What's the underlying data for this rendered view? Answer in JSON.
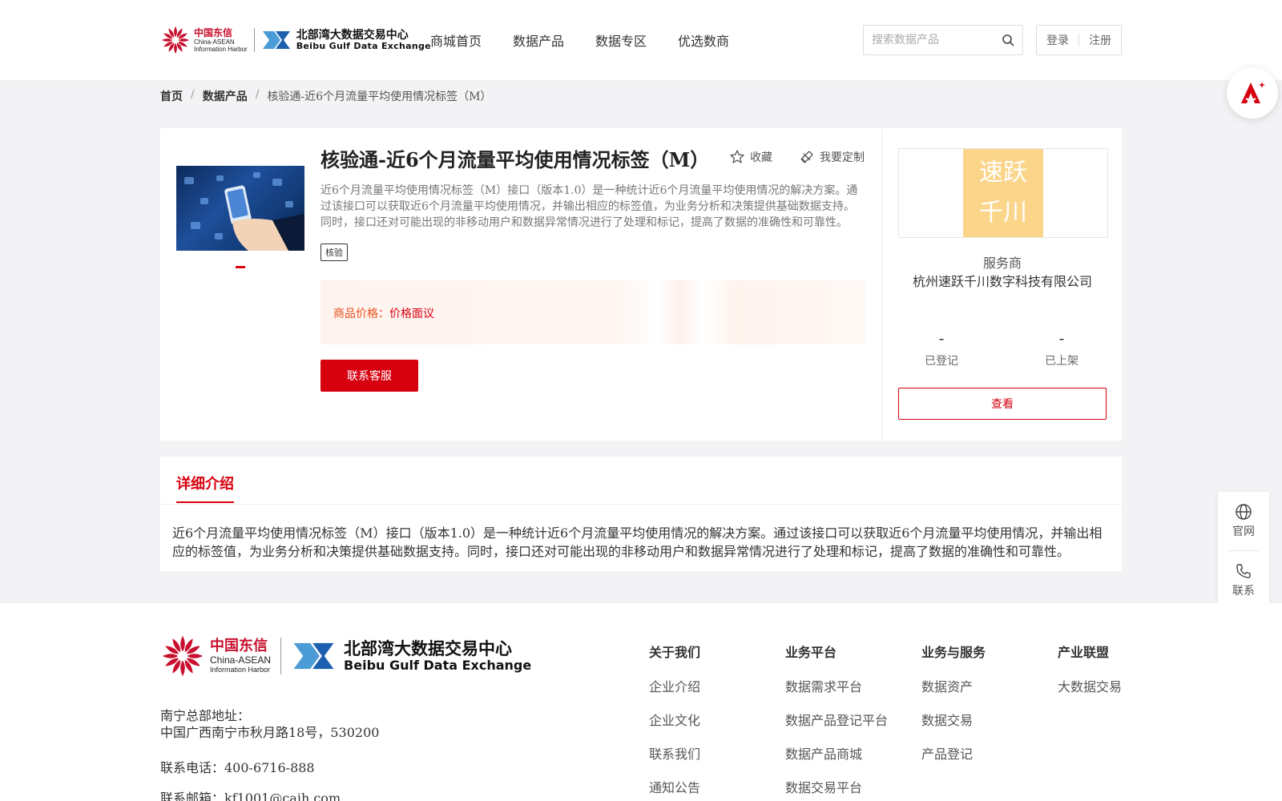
{
  "colors": {
    "brand_red": "#d7000f",
    "price_orange": "#e8501e",
    "bg_gray": "#f3f3f5",
    "vendor_logo_bg": "#fbd58a"
  },
  "header": {
    "logo": {
      "cn_top": "中国东信",
      "en_top": "China-ASEAN",
      "en_bottom": "Information Harbor",
      "bx_cn": "北部湾大数据交易中心",
      "bx_en": "Beibu Gulf Data Exchange"
    },
    "nav": [
      "商城首页",
      "数据产品",
      "数据专区",
      "优选数商"
    ],
    "search": {
      "placeholder": "搜索数据产品",
      "icon": "search-icon"
    },
    "auth": {
      "login": "登录",
      "register": "注册"
    }
  },
  "breadcrumb": {
    "home": "首页",
    "category": "数据产品",
    "sep": "/",
    "current": "核验通-近6个月流量平均使用情况标签（M）"
  },
  "product": {
    "title": "核验通-近6个月流量平均使用情况标签（M）",
    "favorite_label": "收藏",
    "custom_label": "我要定制",
    "description": "近6个月流量平均使用情况标签（M）接口（版本1.0）是一种统计近6个月流量平均使用情况的解决方案。通过该接口可以获取近6个月流量平均使用情况，并输出相应的标签值，为业务分析和决策提供基础数据支持。同时，接口还对可能出现的非移动用户和数据异常情况进行了处理和标记，提高了数据的准确性和可靠性。",
    "tag": "核验",
    "price_label": "商品价格：",
    "price_value": "价格面议",
    "contact_button": "联系客服"
  },
  "vendor": {
    "logo_line1": "速跃",
    "logo_line2": "千川",
    "role": "服务商",
    "name": "杭州速跃千川数字科技有限公司",
    "stats": [
      {
        "value": "-",
        "label": "已登记"
      },
      {
        "value": "-",
        "label": "已上架"
      }
    ],
    "view_button": "查看"
  },
  "detail": {
    "tab": "详细介绍",
    "text": "近6个月流量平均使用情况标签（M）接口（版本1.0）是一种统计近6个月流量平均使用情况的解决方案。通过该接口可以获取近6个月流量平均使用情况，并输出相应的标签值，为业务分析和决策提供基础数据支持。同时，接口还对可能出现的非移动用户和数据异常情况进行了处理和标记，提高了数据的准确性和可靠性。"
  },
  "side_tools": [
    {
      "label": "官网",
      "icon": "globe-icon"
    },
    {
      "label": "联系",
      "icon": "phone-icon"
    }
  ],
  "footer": {
    "address_label": "南宁总部地址：",
    "address": "中国广西南宁市秋月路18号，530200",
    "phone": "联系电话：400-6716-888",
    "email": "联系邮箱：kf1001@caih.com",
    "columns": [
      {
        "head": "关于我们",
        "links": [
          "企业介绍",
          "企业文化",
          "联系我们",
          "通知公告"
        ]
      },
      {
        "head": "业务平台",
        "links": [
          "数据需求平台",
          "数据产品登记平台",
          "数据产品商城",
          "数据交易平台"
        ]
      },
      {
        "head": "业务与服务",
        "links": [
          "数据资产",
          "数据交易",
          "产品登记"
        ]
      },
      {
        "head": "产业联盟",
        "links": [
          "大数据交易"
        ]
      }
    ]
  }
}
